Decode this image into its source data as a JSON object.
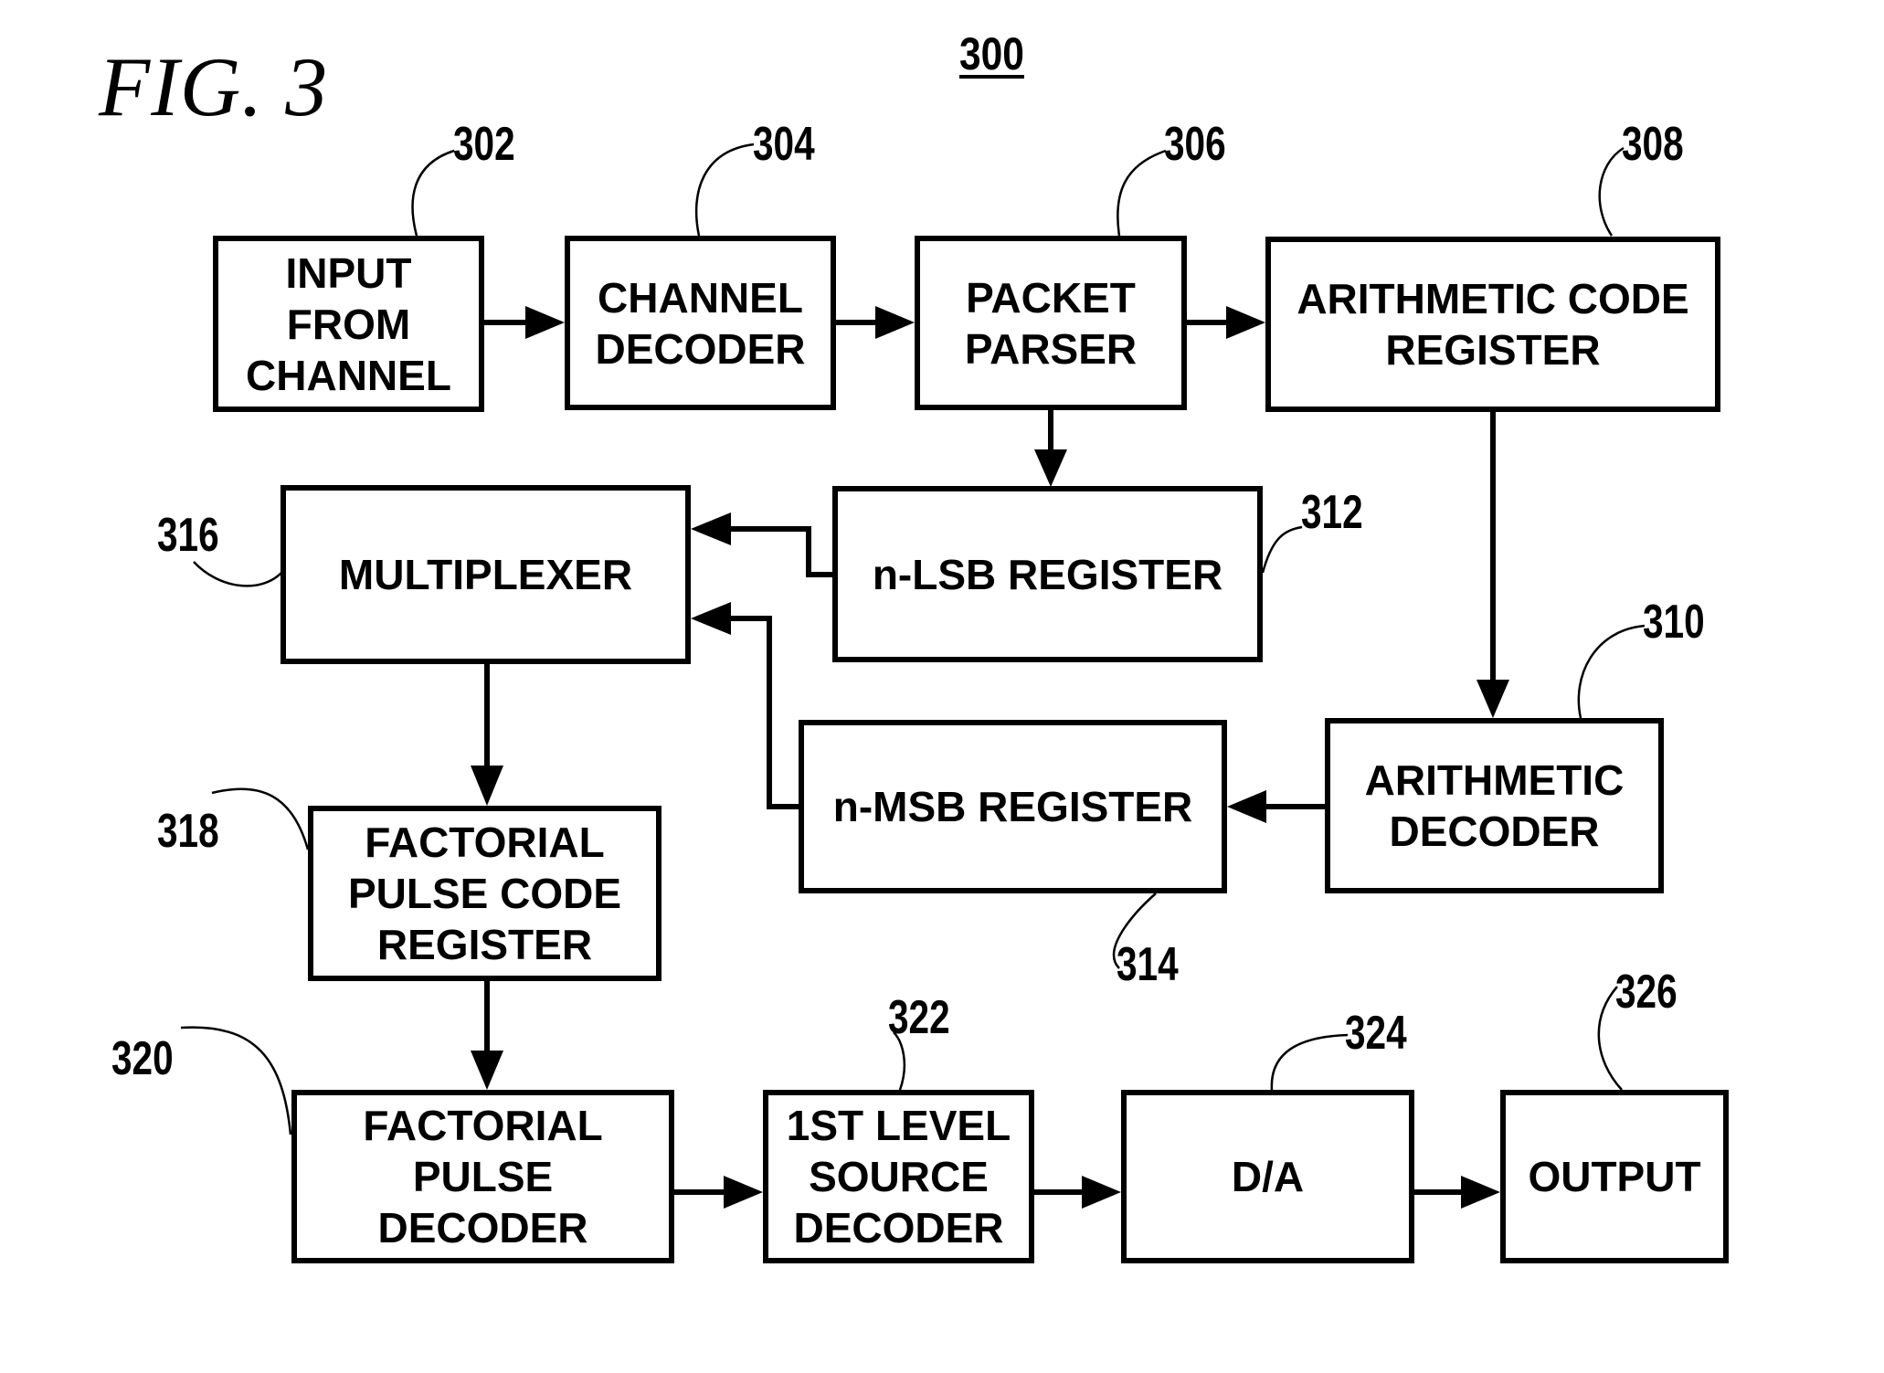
{
  "figure": {
    "title": "FIG. 3",
    "number": "300"
  },
  "blocks": [
    {
      "id": "input_from_channel",
      "label": "INPUT\nFROM\nCHANNEL",
      "ref": "302"
    },
    {
      "id": "channel_decoder",
      "label": "CHANNEL\nDECODER",
      "ref": "304"
    },
    {
      "id": "packet_parser",
      "label": "PACKET\nPARSER",
      "ref": "306"
    },
    {
      "id": "arithmetic_code_register",
      "label": "ARITHMETIC CODE\nREGISTER",
      "ref": "308"
    },
    {
      "id": "arithmetic_decoder",
      "label": "ARITHMETIC\nDECODER",
      "ref": "310"
    },
    {
      "id": "n_lsb_register",
      "label": "n-LSB REGISTER",
      "ref": "312"
    },
    {
      "id": "n_msb_register",
      "label": "n-MSB REGISTER",
      "ref": "314"
    },
    {
      "id": "multiplexer",
      "label": "MULTIPLEXER",
      "ref": "316"
    },
    {
      "id": "factorial_pulse_code_register",
      "label": "FACTORIAL\nPULSE CODE\nREGISTER",
      "ref": "318"
    },
    {
      "id": "factorial_pulse_decoder",
      "label": "FACTORIAL\nPULSE\nDECODER",
      "ref": "320"
    },
    {
      "id": "first_level_source_decoder",
      "label": "1ST LEVEL\nSOURCE\nDECODER",
      "ref": "322"
    },
    {
      "id": "d_a",
      "label": "D/A",
      "ref": "324"
    },
    {
      "id": "output",
      "label": "OUTPUT",
      "ref": "326"
    }
  ],
  "connections": [
    {
      "from": "input_from_channel",
      "to": "channel_decoder"
    },
    {
      "from": "channel_decoder",
      "to": "packet_parser"
    },
    {
      "from": "packet_parser",
      "to": "arithmetic_code_register"
    },
    {
      "from": "packet_parser",
      "to": "n_lsb_register"
    },
    {
      "from": "arithmetic_code_register",
      "to": "arithmetic_decoder"
    },
    {
      "from": "arithmetic_decoder",
      "to": "n_msb_register"
    },
    {
      "from": "n_lsb_register",
      "to": "multiplexer"
    },
    {
      "from": "n_msb_register",
      "to": "multiplexer"
    },
    {
      "from": "multiplexer",
      "to": "factorial_pulse_code_register"
    },
    {
      "from": "factorial_pulse_code_register",
      "to": "factorial_pulse_decoder"
    },
    {
      "from": "factorial_pulse_decoder",
      "to": "first_level_source_decoder"
    },
    {
      "from": "first_level_source_decoder",
      "to": "d_a"
    },
    {
      "from": "d_a",
      "to": "output"
    }
  ]
}
